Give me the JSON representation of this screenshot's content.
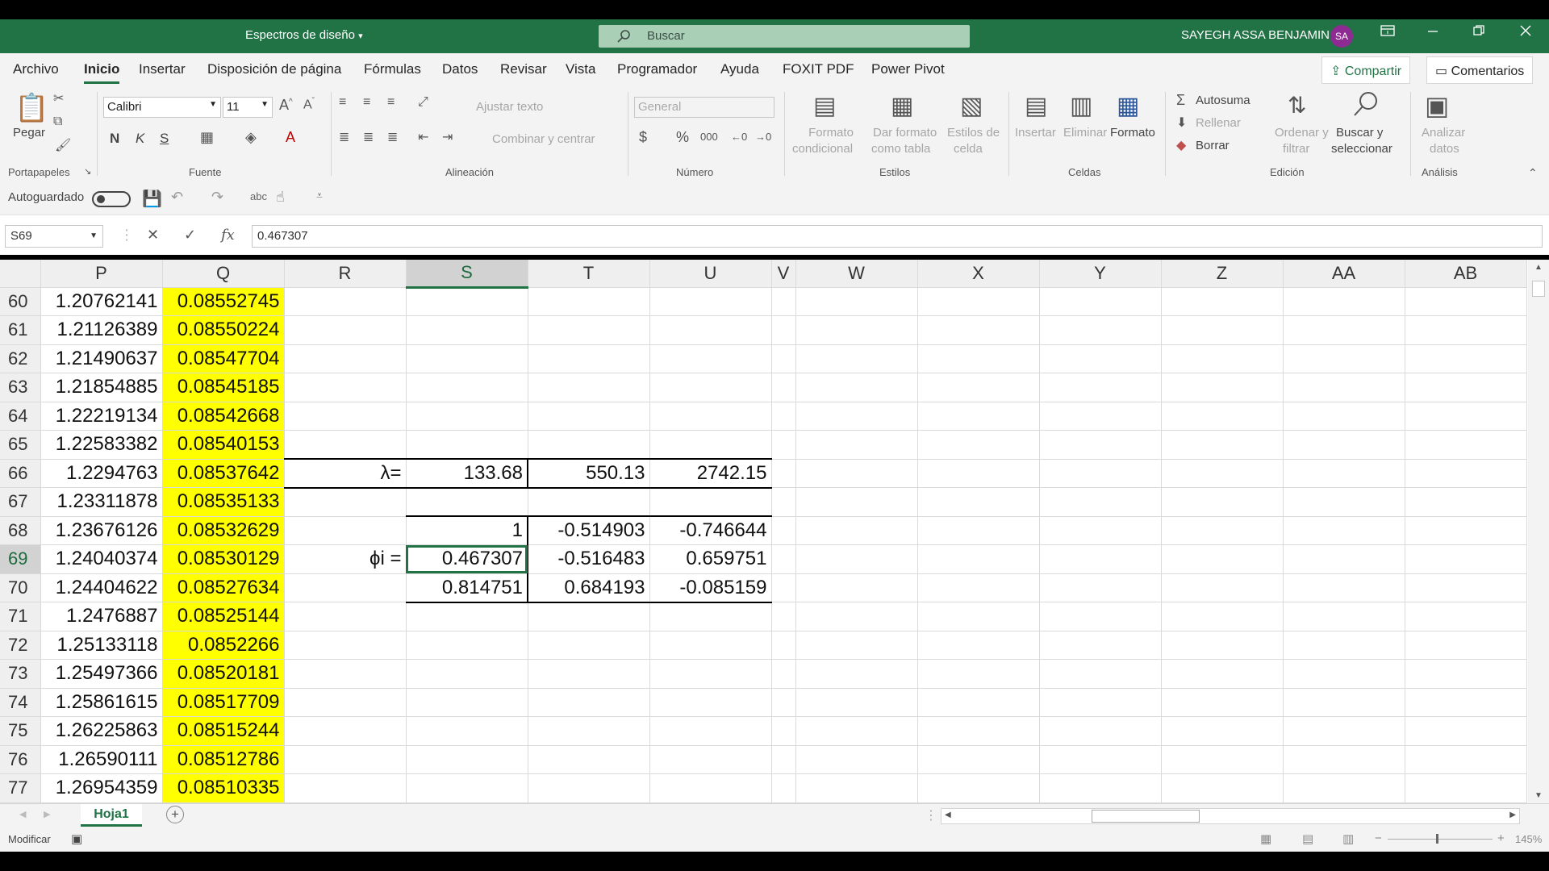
{
  "titlebar": {
    "document_title": "Espectros de diseño",
    "search_placeholder": "Buscar",
    "user_name": "SAYEGH ASSA BENJAMIN",
    "user_initials": "SA"
  },
  "menu": {
    "tabs": [
      "Archivo",
      "Inicio",
      "Insertar",
      "Disposición de página",
      "Fórmulas",
      "Datos",
      "Revisar",
      "Vista",
      "Programador",
      "Ayuda",
      "FOXIT PDF",
      "Power Pivot"
    ],
    "active_tab": "Inicio",
    "share_label": "Compartir",
    "comments_label": "Comentarios"
  },
  "ribbon": {
    "portapapeles": {
      "paste_label": "Pegar",
      "group_label": "Portapapeles"
    },
    "fuente": {
      "font_name": "Calibri",
      "font_size": "11",
      "bold": "N",
      "italic": "K",
      "underline": "S",
      "group_label": "Fuente"
    },
    "alineacion": {
      "wrap_text": "Ajustar texto",
      "merge_center": "Combinar y centrar",
      "group_label": "Alineación"
    },
    "numero": {
      "format_value": "General",
      "group_label": "Número"
    },
    "estilos": {
      "conditional_l1": "Formato",
      "conditional_l2": "condicional",
      "table_l1": "Dar formato",
      "table_l2": "como tabla",
      "cell_l1": "Estilos de",
      "cell_l2": "celda",
      "group_label": "Estilos"
    },
    "celdas": {
      "insert": "Insertar",
      "delete": "Eliminar",
      "format": "Formato",
      "group_label": "Celdas"
    },
    "edicion": {
      "autosum": "Autosuma",
      "fill": "Rellenar",
      "clear": "Borrar",
      "sort_l1": "Ordenar y",
      "sort_l2": "filtrar",
      "find_l1": "Buscar y",
      "find_l2": "seleccionar",
      "group_label": "Edición"
    },
    "analisis": {
      "analyze_l1": "Analizar",
      "analyze_l2": "datos",
      "group_label": "Análisis"
    }
  },
  "qat": {
    "autosave_label": "Autoguardado"
  },
  "formula_bar": {
    "name_box": "S69",
    "formula": "0.467307"
  },
  "sheet": {
    "columns": [
      "P",
      "Q",
      "R",
      "S",
      "T",
      "U",
      "V",
      "W",
      "X",
      "Y",
      "Z",
      "AA",
      "AB"
    ],
    "selected_column": "S",
    "selected_row": "69",
    "rows": [
      {
        "n": "60",
        "P": "1.20762141",
        "Q": "0.08552745"
      },
      {
        "n": "61",
        "P": "1.21126389",
        "Q": "0.08550224"
      },
      {
        "n": "62",
        "P": "1.21490637",
        "Q": "0.08547704"
      },
      {
        "n": "63",
        "P": "1.21854885",
        "Q": "0.08545185"
      },
      {
        "n": "64",
        "P": "1.22219134",
        "Q": "0.08542668"
      },
      {
        "n": "65",
        "P": "1.22583382",
        "Q": "0.08540153"
      },
      {
        "n": "66",
        "P": "1.2294763",
        "Q": "0.08537642",
        "R": "λ=",
        "S": "133.68",
        "T": "550.13",
        "U": "2742.15"
      },
      {
        "n": "67",
        "P": "1.23311878",
        "Q": "0.08535133"
      },
      {
        "n": "68",
        "P": "1.23676126",
        "Q": "0.08532629",
        "S": "1",
        "T": "-0.514903",
        "U": "-0.746644"
      },
      {
        "n": "69",
        "P": "1.24040374",
        "Q": "0.08530129",
        "R": "ϕi =",
        "S": "0.467307",
        "T": "-0.516483",
        "U": "0.659751"
      },
      {
        "n": "70",
        "P": "1.24404622",
        "Q": "0.08527634",
        "S": "0.814751",
        "T": "0.684193",
        "U": "-0.085159"
      },
      {
        "n": "71",
        "P": "1.2476887",
        "Q": "0.08525144"
      },
      {
        "n": "72",
        "P": "1.25133118",
        "Q": "0.0852266"
      },
      {
        "n": "73",
        "P": "1.25497366",
        "Q": "0.08520181"
      },
      {
        "n": "74",
        "P": "1.25861615",
        "Q": "0.08517709"
      },
      {
        "n": "75",
        "P": "1.26225863",
        "Q": "0.08515244"
      },
      {
        "n": "76",
        "P": "1.26590111",
        "Q": "0.08512786"
      },
      {
        "n": "77",
        "P": "1.26954359",
        "Q": "0.08510335"
      }
    ]
  },
  "sheet_tabs": [
    "Hoja1"
  ],
  "status": {
    "mode": "Modificar",
    "zoom": "145%"
  },
  "colors": {
    "excel_green": "#217346",
    "highlight_yellow": "#ffff00"
  }
}
